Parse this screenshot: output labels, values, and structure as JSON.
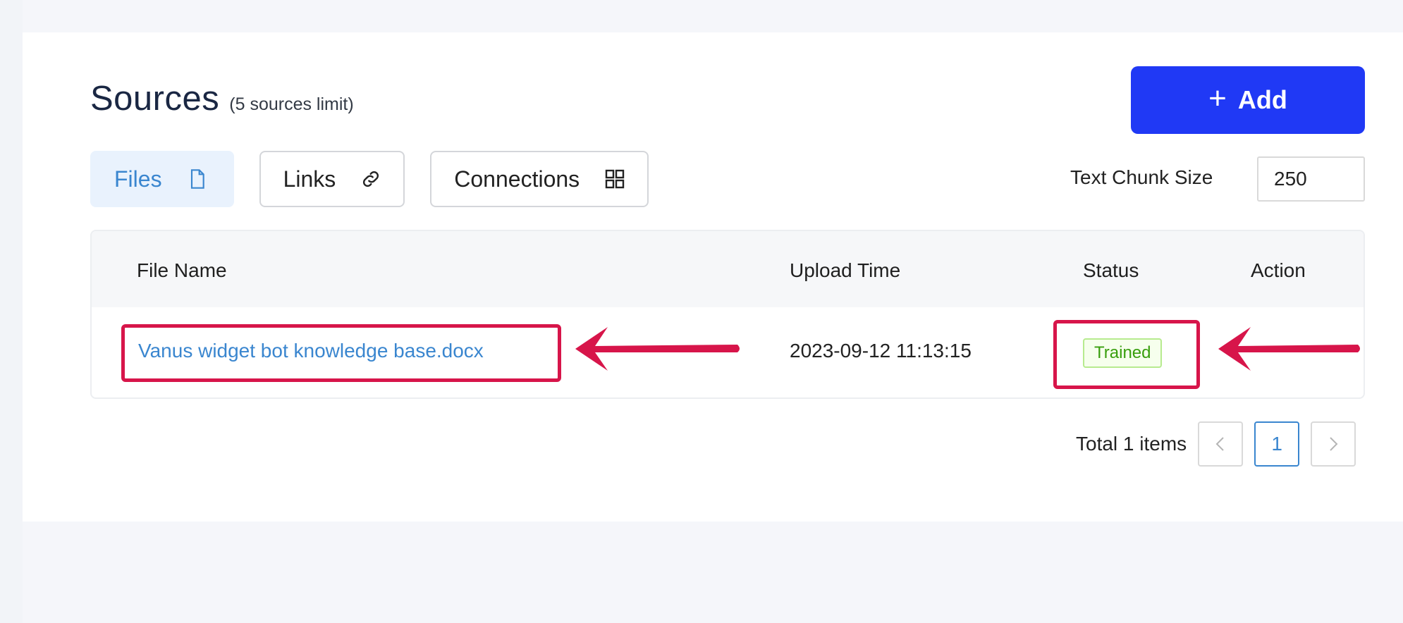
{
  "header": {
    "title": "Sources",
    "subtitle": "(5 sources limit)",
    "add_button": {
      "label": "Add",
      "icon": "plus-icon"
    }
  },
  "tabs": [
    {
      "label": "Files",
      "icon": "file-icon",
      "active": true
    },
    {
      "label": "Links",
      "icon": "link-icon",
      "active": false
    },
    {
      "label": "Connections",
      "icon": "grid-icon",
      "active": false
    }
  ],
  "chunk_size": {
    "label": "Text Chunk Size",
    "value": "250"
  },
  "table": {
    "columns": [
      "File Name",
      "Upload Time",
      "Status",
      "Action"
    ],
    "rows": [
      {
        "file_name": "Vanus widget bot knowledge base.docx",
        "upload_time": "2023-09-12 11:13:15",
        "status": "Trained",
        "action": ""
      }
    ]
  },
  "pagination": {
    "total_text": "Total 1 items",
    "current_page": "1",
    "prev_icon": "chevron-left-icon",
    "next_icon": "chevron-right-icon"
  },
  "colors": {
    "accent": "#2039f5",
    "link": "#3a86cf",
    "highlight": "#d7154a",
    "status_success": "#389e0d"
  }
}
